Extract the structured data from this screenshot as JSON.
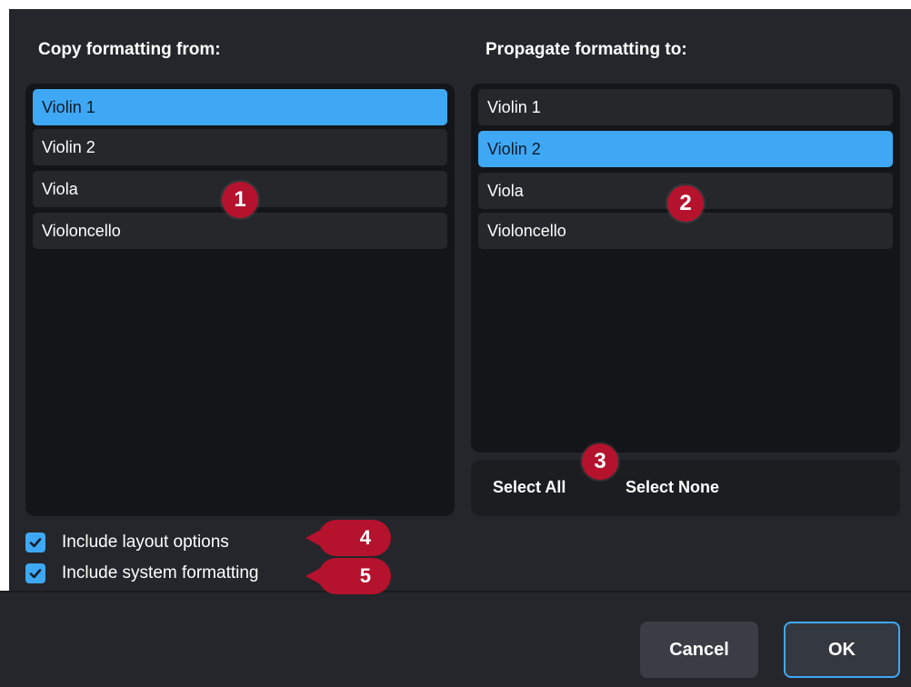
{
  "copy_from": {
    "label": "Copy formatting from:",
    "items": [
      "Violin 1",
      "Violin 2",
      "Viola",
      "Violoncello"
    ],
    "selected_index": 0
  },
  "propagate_to": {
    "label": "Propagate formatting to:",
    "items": [
      "Violin 1",
      "Violin 2",
      "Viola",
      "Violoncello"
    ],
    "selected_index": 1,
    "select_all_label": "Select All",
    "select_none_label": "Select None"
  },
  "options": {
    "include_layout": {
      "label": "Include layout options",
      "checked": true
    },
    "include_system": {
      "label": "Include system formatting",
      "checked": true
    }
  },
  "callouts": [
    "1",
    "2",
    "3",
    "4",
    "5"
  ],
  "buttons": {
    "cancel": "Cancel",
    "ok": "OK"
  },
  "colors": {
    "accent": "#3ea8f5",
    "callout": "#b5122d"
  }
}
